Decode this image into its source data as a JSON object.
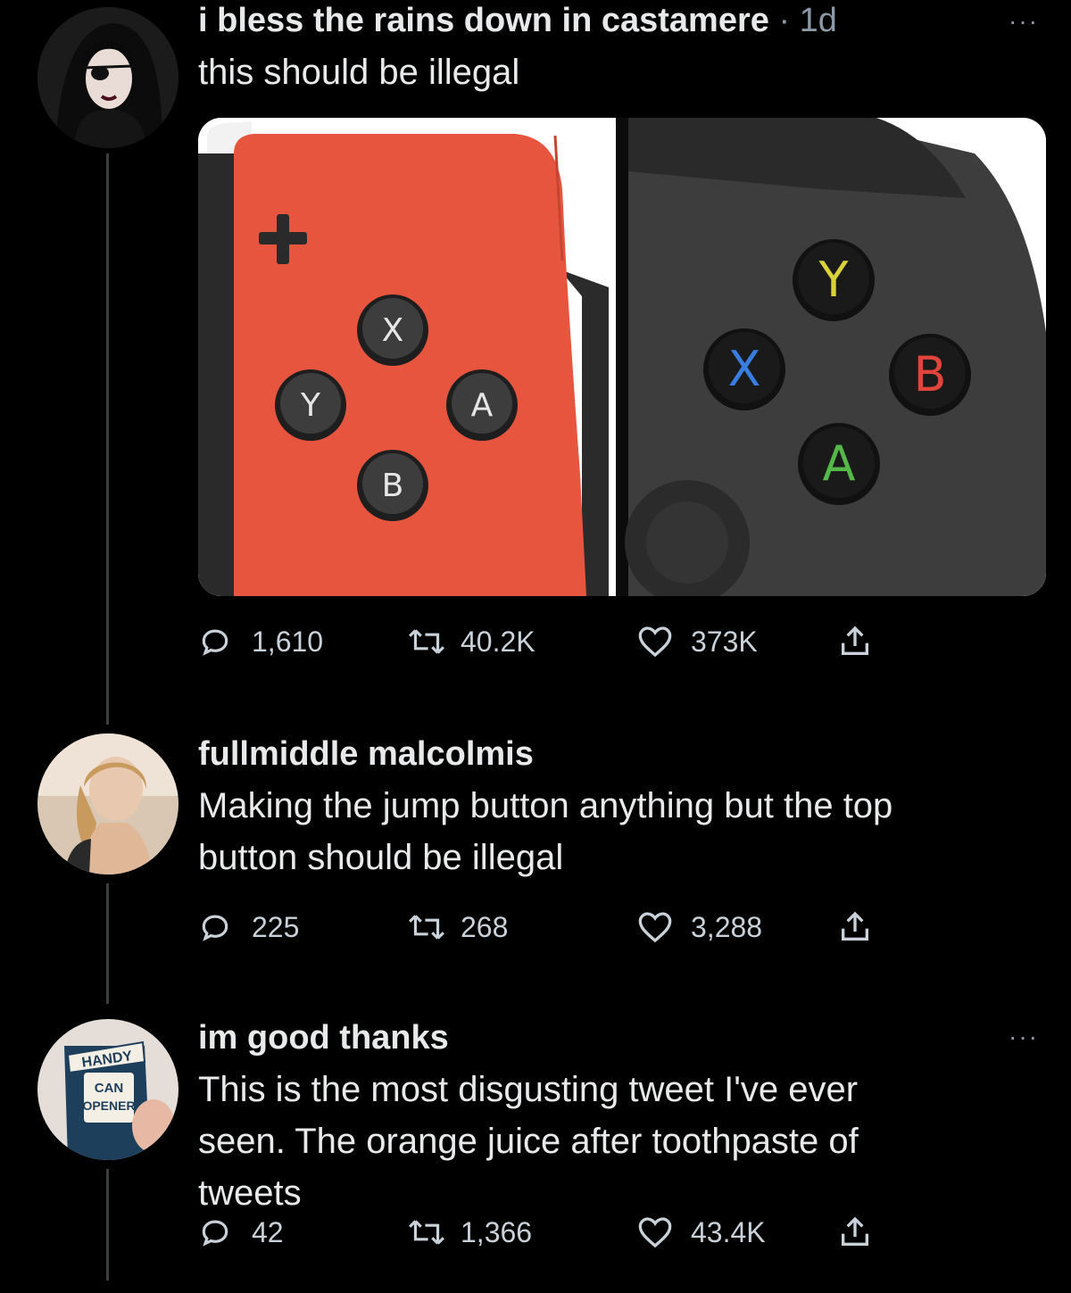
{
  "tweets": [
    {
      "name": "i bless the rains down in castamere",
      "time": " · 1d",
      "text": "this should be illegal",
      "more": "···",
      "replies": "1,610",
      "retweets": "40.2K",
      "likes": "373K",
      "media": {
        "left_buttons": [
          "X",
          "Y",
          "A",
          "B"
        ],
        "right_buttons": [
          "Y",
          "X",
          "B",
          "A"
        ],
        "colors": {
          "joycon": "#e8553f",
          "xbox_body": "#3d3d3d",
          "xbox_y": "#d9d238",
          "xbox_x": "#3a7de0",
          "xbox_b": "#e0443a",
          "xbox_a": "#55b848"
        }
      }
    },
    {
      "name": "fullmiddle malcolmis",
      "text_lines": [
        "Making the jump button anything but the top",
        "button should be illegal"
      ],
      "replies": "225",
      "retweets": "268",
      "likes": "3,288"
    },
    {
      "name": "im good thanks",
      "text_lines": [
        "This is the most disgusting tweet I've ever",
        "seen. The orange juice after toothpaste of",
        "tweets"
      ],
      "more": "···",
      "replies": "42",
      "retweets": "1,366",
      "likes": "43.4K",
      "avatar_text": [
        "HANDY",
        "CAN",
        "OPENER"
      ]
    }
  ]
}
